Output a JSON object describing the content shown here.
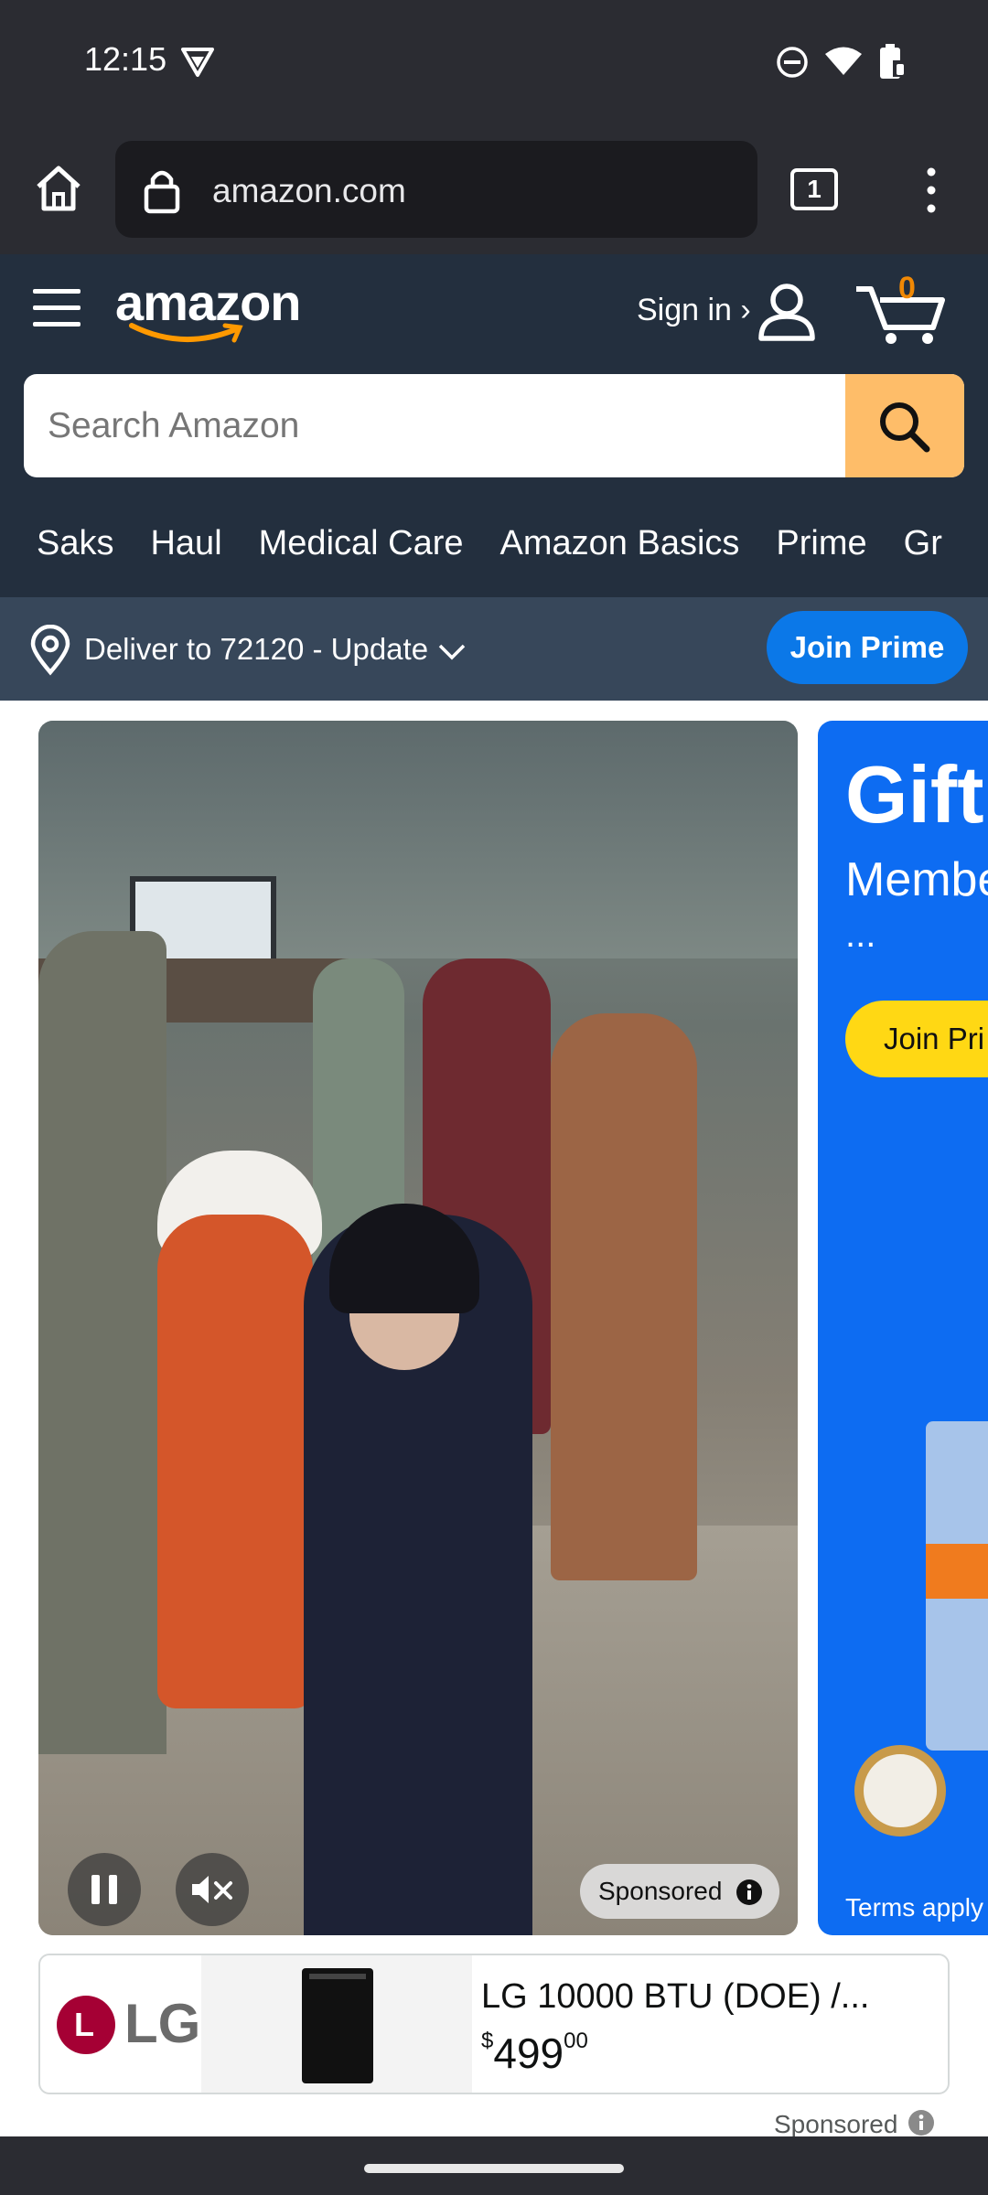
{
  "status_bar": {
    "time": "12:15"
  },
  "browser": {
    "url": "amazon.com",
    "tab_count": "1"
  },
  "header": {
    "logo_text": "amazon",
    "sign_in": "Sign in ›",
    "cart_count": "0"
  },
  "search": {
    "placeholder": "Search Amazon"
  },
  "nav_links": [
    "Saks",
    "Haul",
    "Medical Care",
    "Amazon Basics",
    "Prime",
    "Gr"
  ],
  "delivery": {
    "text": "Deliver to 72120 - Update",
    "join_prime": "Join Prime"
  },
  "video_card": {
    "sponsored": "Sponsored"
  },
  "promo_card": {
    "title": "Gift",
    "subtitle": "Membe",
    "ellipsis": "...",
    "button": "Join Pri",
    "terms": "Terms apply"
  },
  "ad": {
    "brand": "LG",
    "title": "LG 10000 BTU (DOE) /...",
    "price_symbol": "$",
    "price_whole": "499",
    "price_fraction": "00",
    "sponsored": "Sponsored"
  },
  "colors": {
    "amazon_dark": "#232f3e",
    "amazon_orange": "#ff9900",
    "search_button": "#febd69",
    "prime_blue": "#0b78e8",
    "delivery_bar": "#37475a"
  }
}
